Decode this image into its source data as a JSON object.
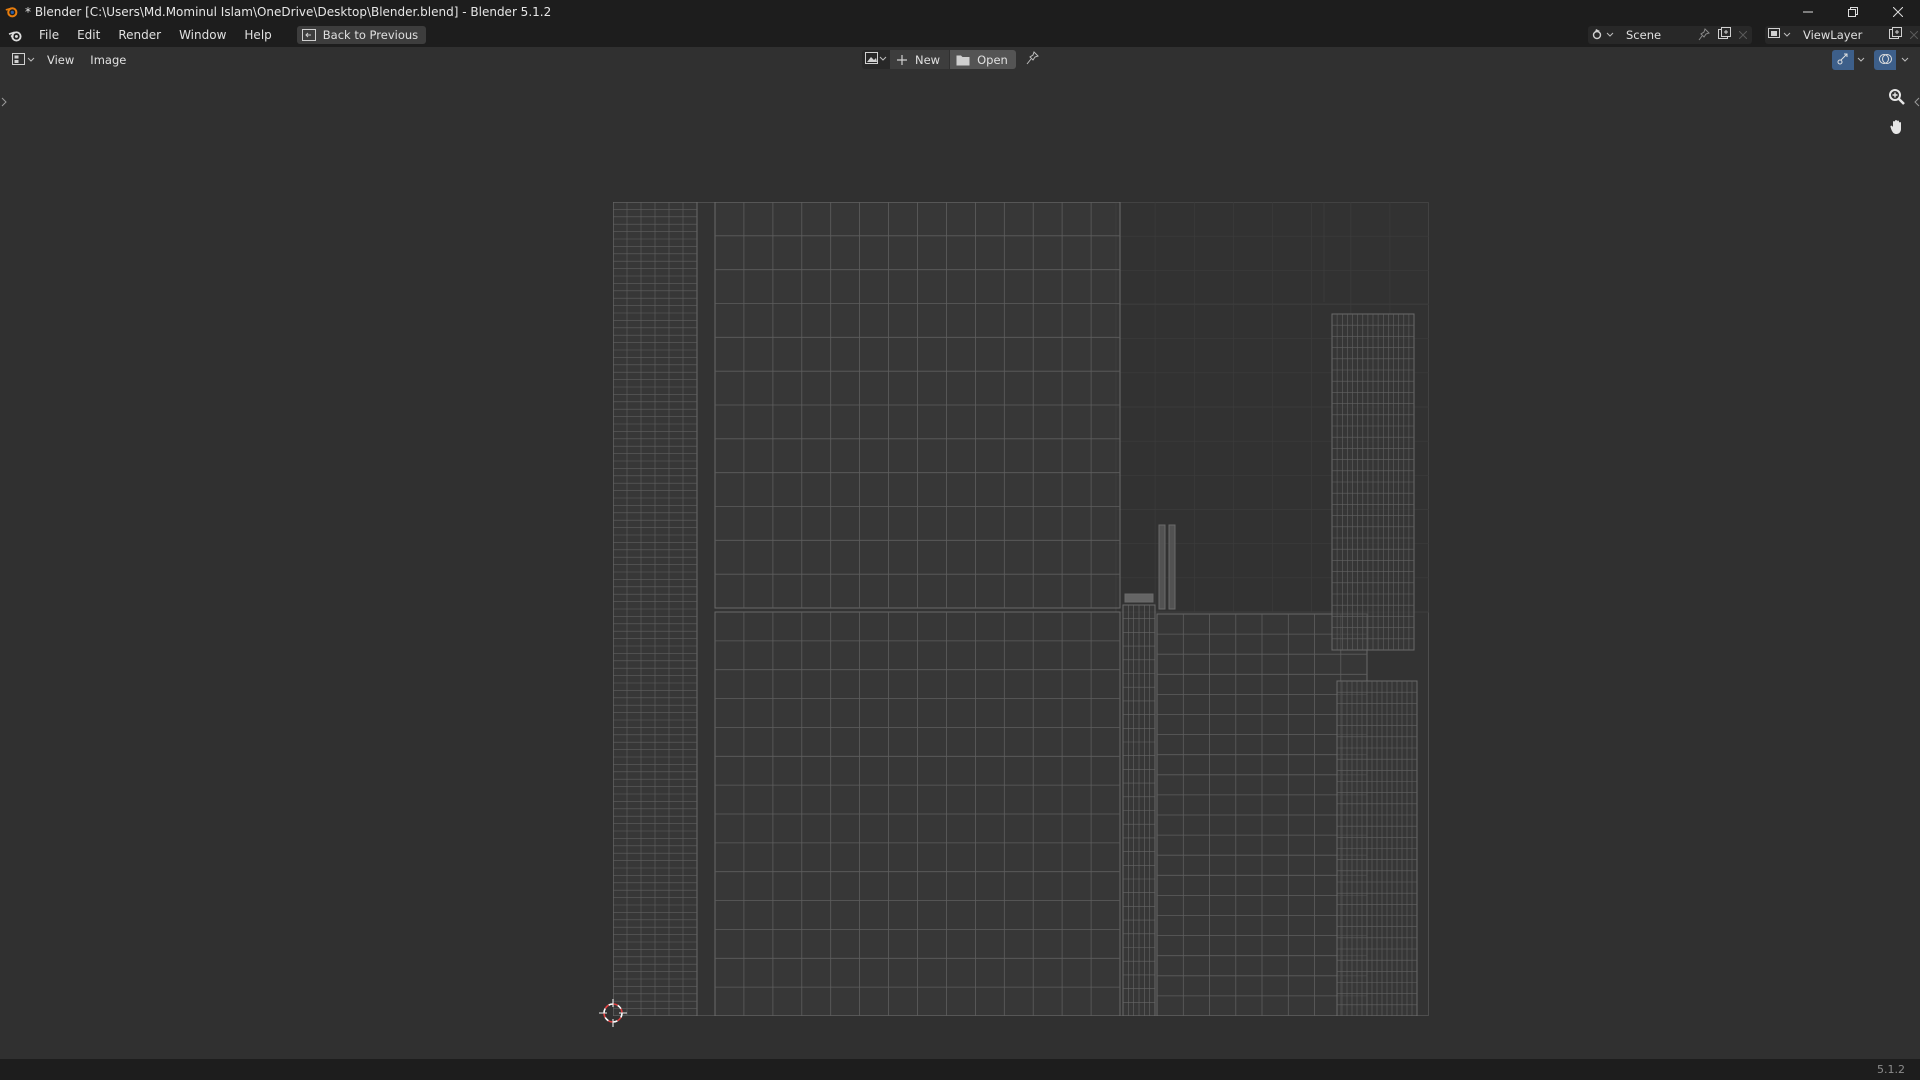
{
  "window": {
    "title": "* Blender [C:\\Users\\Md.Mominul Islam\\OneDrive\\Desktop\\Blender.blend] - Blender 5.1.2"
  },
  "menu": {
    "items": [
      "File",
      "Edit",
      "Render",
      "Window",
      "Help"
    ],
    "back_button": "Back to Previous"
  },
  "scene": {
    "name": "Scene"
  },
  "view_layer": {
    "name": "ViewLayer"
  },
  "editor": {
    "menus": [
      "View",
      "Image"
    ],
    "new_label": "New",
    "open_label": "Open"
  },
  "status": {
    "version": "5.1.2"
  },
  "colors": {
    "background": "#303030",
    "header": "#1d1d1d",
    "wire": "#5e5e5e",
    "accent_orange": "#e87d0d",
    "cursor_red": "#e04040"
  },
  "icons": [
    "blender-icon",
    "back-icon",
    "scene-icon",
    "pin-icon",
    "new-icon",
    "open-folder-icon",
    "view-layer-icon",
    "image-browse-icon",
    "overlay-icon",
    "zoom-icon",
    "hand-icon",
    "cursor-icon"
  ]
}
